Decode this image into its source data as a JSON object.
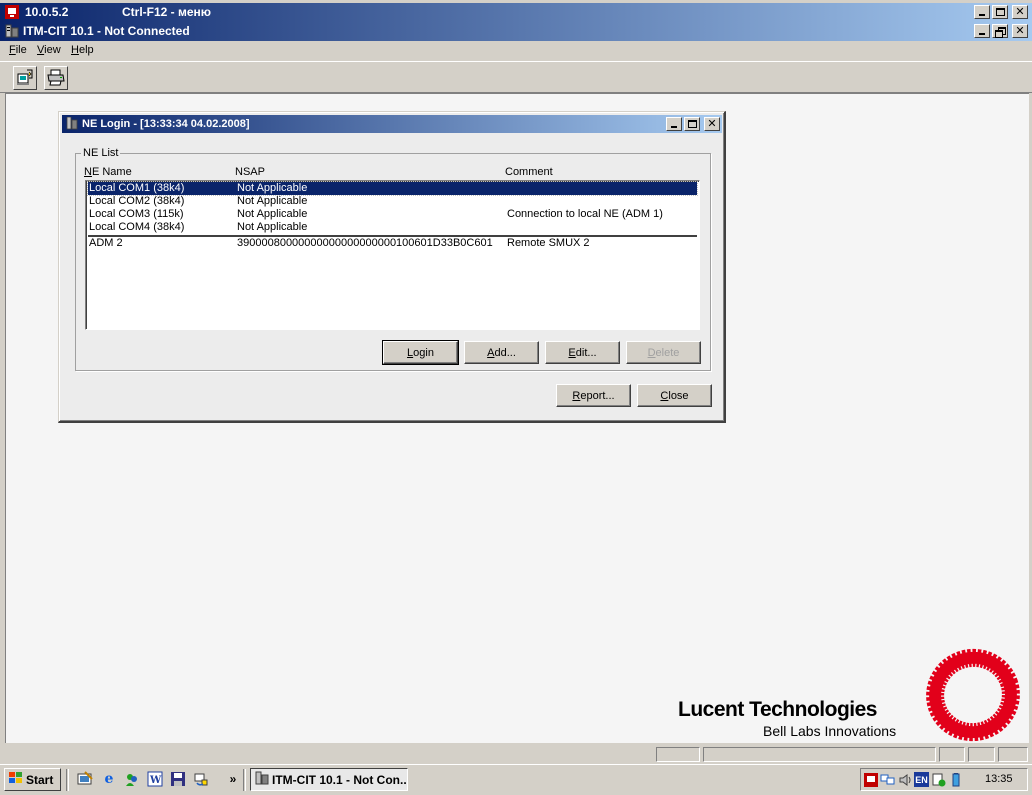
{
  "remote_bar": {
    "title": "10.0.5.2",
    "hint": "Ctrl-F12 - меню"
  },
  "app": {
    "title": "ITM-CIT 10.1 - Not Connected"
  },
  "menu": {
    "items": [
      "File",
      "View",
      "Help"
    ]
  },
  "toolbar": {
    "buttons": [
      "login-toolbar-icon",
      "print-toolbar-icon"
    ]
  },
  "dialog": {
    "title": "NE Login - [13:33:34 04.02.2008]",
    "group_label": "NE List",
    "columns": [
      "NE Name",
      "NSAP",
      "Comment"
    ],
    "rows": [
      {
        "name": "Local COM1 (38k4)",
        "nsap": "Not Applicable",
        "comment": "",
        "selected": true
      },
      {
        "name": "Local COM2 (38k4)",
        "nsap": "Not Applicable",
        "comment": "",
        "selected": false
      },
      {
        "name": "Local COM3 (115k)",
        "nsap": "Not Applicable",
        "comment": "Connection to local NE (ADM 1)",
        "selected": false
      },
      {
        "name": "Local COM4 (38k4)",
        "nsap": "Not Applicable",
        "comment": "",
        "selected": false
      },
      {
        "name": "ADM 2",
        "nsap": "39000080000000000000000000100601D33B0C601",
        "comment": "Remote SMUX 2",
        "selected": false
      }
    ],
    "buttons": {
      "login": "Login",
      "add": "Add...",
      "edit": "Edit...",
      "delete": "Delete",
      "report": "Report...",
      "close": "Close"
    }
  },
  "logo": {
    "company": "Lucent Technologies",
    "tagline": "Bell Labs Innovations",
    "brand_color": "#e2001a"
  },
  "taskbar": {
    "start_label": "Start",
    "task_label": "ITM-CIT 10.1 - Not Con...",
    "chevron": "»",
    "tray_lang": "EN",
    "clock": "13:35"
  },
  "colors": {
    "titlebar_start": "#0a246a",
    "titlebar_end": "#a6caf0",
    "selection": "#0a246a"
  }
}
